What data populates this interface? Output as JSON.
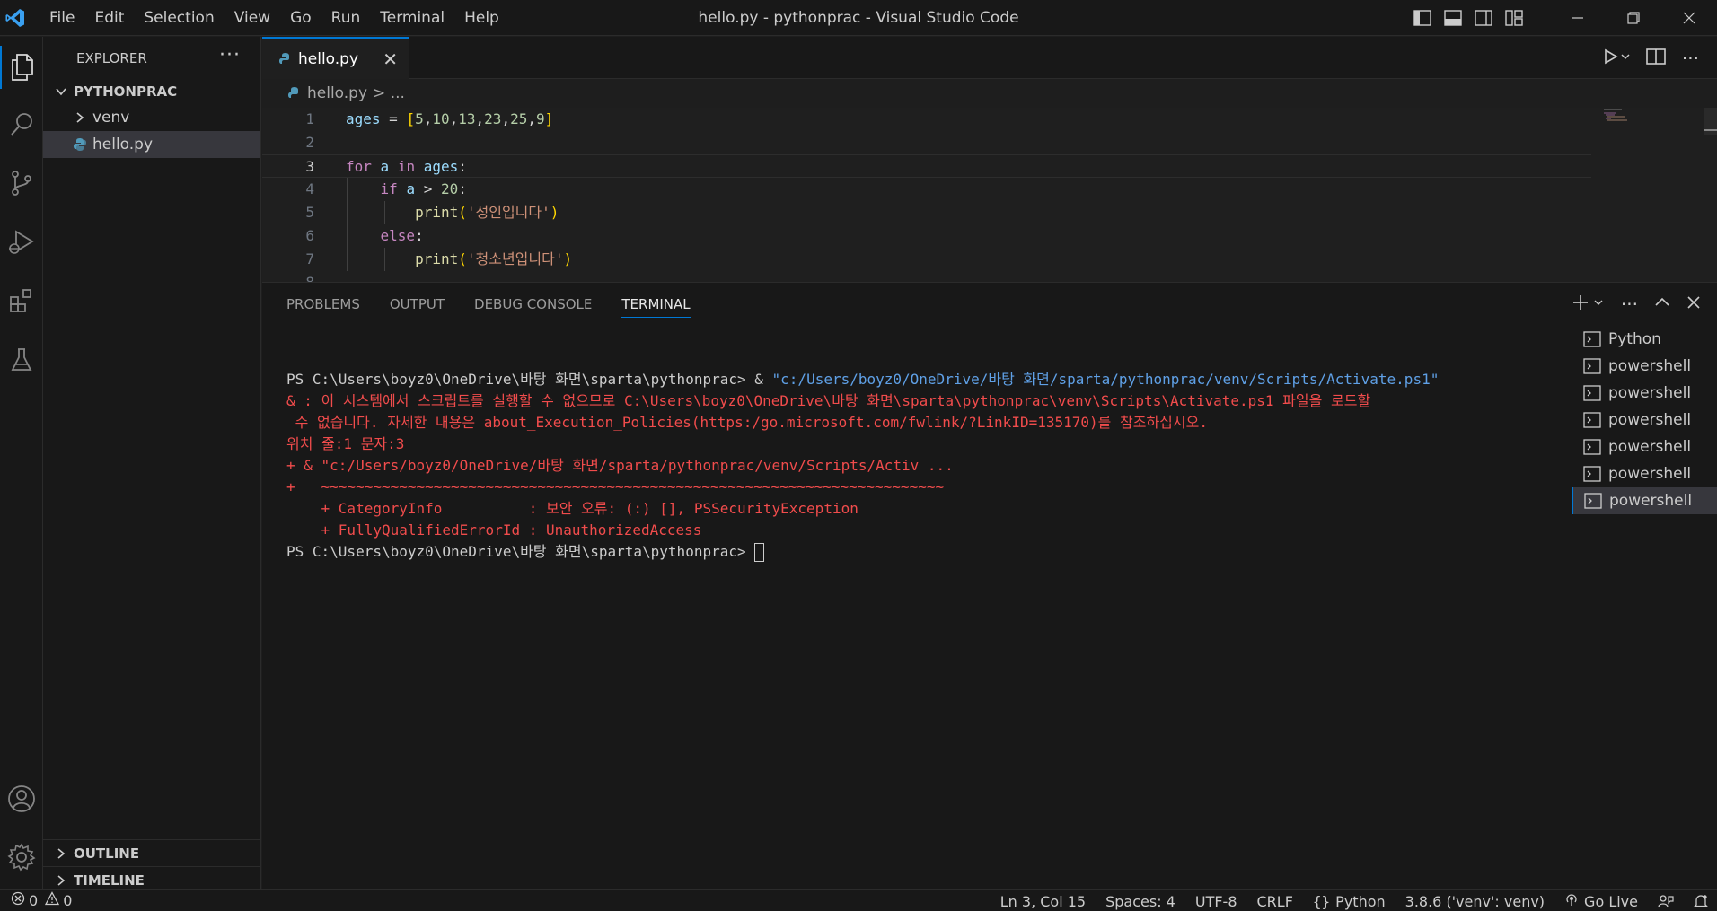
{
  "window": {
    "title": "hello.py - pythonprac - Visual Studio Code"
  },
  "menu": [
    "File",
    "Edit",
    "Selection",
    "View",
    "Go",
    "Run",
    "Terminal",
    "Help"
  ],
  "sidebar": {
    "title": "EXPLORER",
    "more": "···",
    "root": "PYTHONPRAC",
    "items": [
      {
        "label": "venv",
        "type": "folder"
      },
      {
        "label": "hello.py",
        "type": "file",
        "selected": true
      }
    ],
    "outline": "OUTLINE",
    "timeline": "TIMELINE"
  },
  "editor": {
    "tab_label": "hello.py",
    "breadcrumb_file": "hello.py",
    "breadcrumb_rest": "> ...",
    "current_line": 3
  },
  "panel": {
    "tabs": [
      "PROBLEMS",
      "OUTPUT",
      "DEBUG CONSOLE",
      "TERMINAL"
    ],
    "active_tab": "TERMINAL",
    "terminal": {
      "prompt_1": "PS C:\\Users\\boyz0\\OneDrive\\바탕 화면\\sparta\\pythonprac> & ",
      "command_1": "\"c:/Users/boyz0/OneDrive/바탕 화면/sparta/pythonprac/venv/Scripts/Activate.ps1\"",
      "error_lines": [
        "& : 이 시스템에서 스크립트를 실행할 수 없으므로 C:\\Users\\boyz0\\OneDrive\\바탕 화면\\sparta\\pythonprac\\venv\\Scripts\\Activate.ps1 파일을 로드할",
        " 수 없습니다. 자세한 내용은 about_Execution_Policies(https:/go.microsoft.com/fwlink/?LinkID=135170)를 참조하십시오.",
        "위치 줄:1 문자:3",
        "+ & \"c:/Users/boyz0/OneDrive/바탕 화면/sparta/pythonprac/venv/Scripts/Activ ...",
        "+   ~~~~~~~~~~~~~~~~~~~~~~~~~~~~~~~~~~~~~~~~~~~~~~~~~~~~~~~~~~~~~~~~~~~~~~~~",
        "    + CategoryInfo          : 보안 오류: (:) [], PSSecurityException",
        "    + FullyQualifiedErrorId : UnauthorizedAccess"
      ],
      "prompt_2": "PS C:\\Users\\boyz0\\OneDrive\\바탕 화면\\sparta\\pythonprac> "
    },
    "terminals": [
      {
        "label": "Python",
        "active": false
      },
      {
        "label": "powershell",
        "active": false
      },
      {
        "label": "powershell",
        "active": false
      },
      {
        "label": "powershell",
        "active": false
      },
      {
        "label": "powershell",
        "active": false
      },
      {
        "label": "powershell",
        "active": false
      },
      {
        "label": "powershell",
        "active": true
      }
    ]
  },
  "statusbar": {
    "errors": "0",
    "warnings": "0",
    "position": "Ln 3, Col 15",
    "spaces": "Spaces: 4",
    "encoding": "UTF-8",
    "eol": "CRLF",
    "language": "Python",
    "interpreter": "3.8.6 ('venv': venv)",
    "golive": "Go Live"
  },
  "colors": {
    "accent": "#0078d4",
    "error": "#f14c4c",
    "keyword": "#c586c0",
    "variable": "#9cdcfe",
    "number": "#b5cea8",
    "function": "#dcdcaa",
    "string": "#ce9178"
  },
  "icons": {
    "activity": [
      "explorer-icon",
      "search-icon",
      "source-control-icon",
      "run-debug-icon",
      "extensions-icon",
      "testing-icon",
      "account-icon",
      "manage-gear-icon"
    ]
  }
}
